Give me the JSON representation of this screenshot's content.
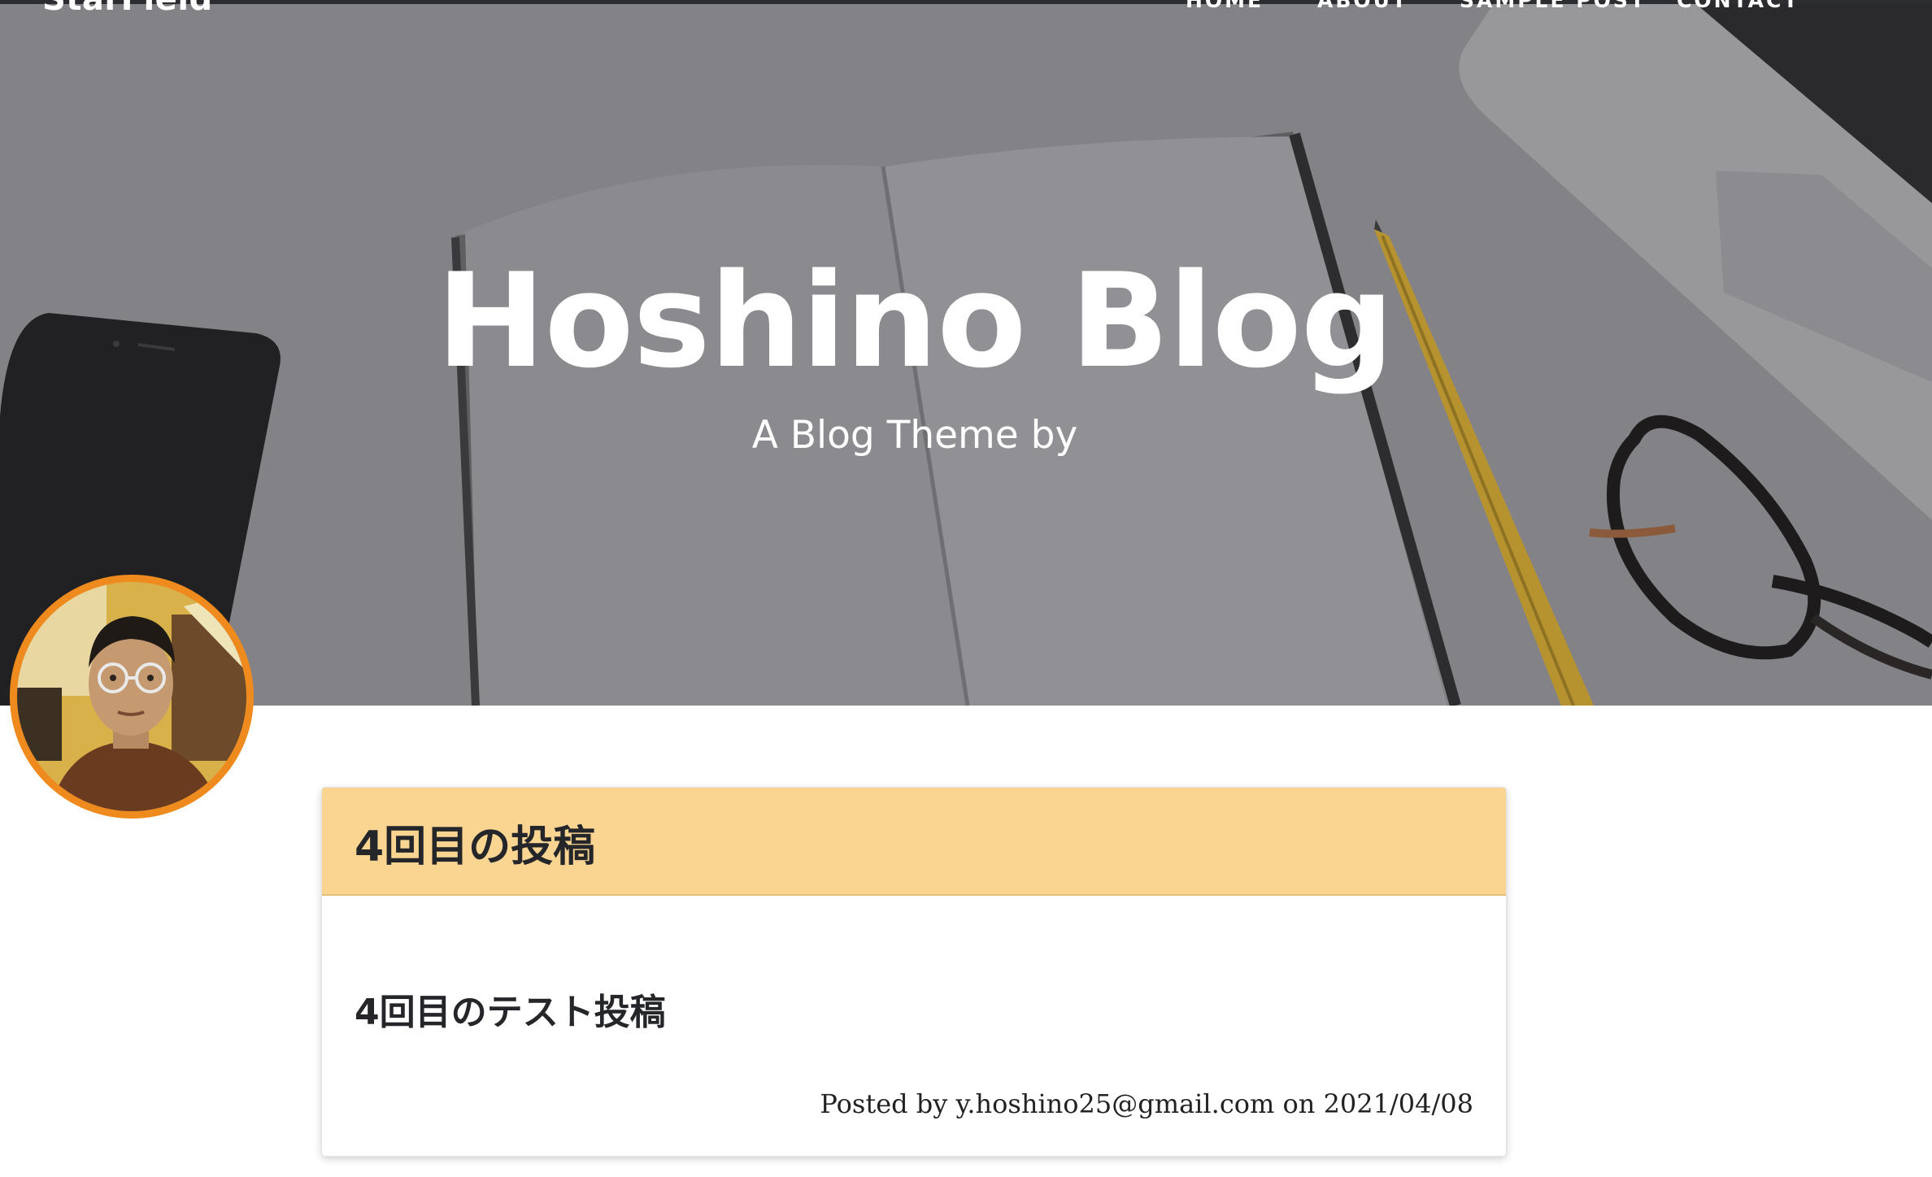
{
  "header": {
    "brand": "StarField",
    "nav": [
      "HOME",
      "ABOUT",
      "SAMPLE POST",
      "CONTACT"
    ]
  },
  "hero": {
    "title": "Hoshino Blog",
    "subtitle": "A Blog Theme by"
  },
  "post": {
    "title": "4回目の投稿",
    "body": "4回目のテスト投稿",
    "meta": "Posted by y.hoshino25@gmail.com on 2021/04/08"
  },
  "colors": {
    "accent_orange": "#ef8a1f",
    "card_header": "#fad591",
    "hero_overlay": "#7f7f82"
  }
}
